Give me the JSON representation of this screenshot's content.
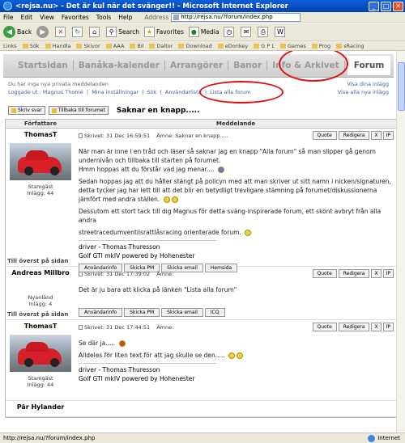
{
  "window": {
    "title": "<rejsa.nu> - Det är kul när det svänger!! - Microsoft Internet Explorer"
  },
  "menu": {
    "items": [
      "File",
      "Edit",
      "View",
      "Favorites",
      "Tools",
      "Help"
    ],
    "address_label": "Address",
    "url": "http://rejsa.nu/?forum/index.php"
  },
  "toolbar": {
    "back": "Back",
    "search": "Search",
    "favorites": "Favorites",
    "media": "Media"
  },
  "links": {
    "label": "Links",
    "items": [
      "Sök",
      "Handla",
      "Skivor",
      "AAA",
      "Bil",
      "Daltor",
      "Download",
      "eDonkey",
      "G P L",
      "Games",
      "Prog",
      "sRacing"
    ]
  },
  "nav": {
    "tabs": [
      "Startsidan",
      "Banåka-kalender",
      "Arrangörer",
      "Banor",
      "Info & Arkivet",
      "Forum"
    ]
  },
  "info": {
    "line1": "Du har inga nya privata meddelanden",
    "line2_prefix": "Loggade ut : Magnus Thomé",
    "mine": "Mina inställningar",
    "search": "Sök",
    "users": "Användarlista",
    "list_all": "Lista alla forum",
    "right1": "Visa dina inlägg",
    "right2": "Visa alla nya inlägg"
  },
  "buttons": {
    "reply": "Skriv svar",
    "back": "Tillbaka till forumet"
  },
  "thread": {
    "title": "Saknar en knapp....."
  },
  "table": {
    "col_author": "Författare",
    "col_message": "Meddelande"
  },
  "actions": {
    "quote": "Quote",
    "edit": "Redigera",
    "del": "X",
    "ip": "IP"
  },
  "foot_btns": {
    "info": "Användarinfo",
    "pm": "Skicka PM",
    "email": "Skicka email",
    "web": "Hemsida",
    "icq": "ICQ"
  },
  "posts": [
    {
      "author": "ThomasT",
      "rank": "Stamgäst",
      "count": "Inlägg: 44",
      "date": "Skrivet: 31 Dec 16:59:51",
      "subject": "Ämne: Saknar en knapp.....",
      "p1": "När man är inne i en tråd och läser så saknar jag en knapp \"Alla forum\" så man slipper gå genom undernivån och tillbaka till starten på forumet.",
      "p1b": "Hmm hoppas att du förstår vad jag menar....",
      "p2": "Sedan hoppas jag att du håller stängt på policyn med att man skriver ut sitt namn i nicken/signaturen, detta tycker jag har lett till att det blir en betydligt trevligare stämning på forumet/diskussionerna jämfört med andra ställen.",
      "p3": "Dessutom ett stort tack till dig Magnus för detta sväng-inspirerade forum, ett skönt avbryt från alla andra",
      "p4": "streetracedumventilsrattlåsracing orienterade forum.",
      "sig1": "driver - Thomas Thuresson",
      "sig2": "Golf GTI mkIV powered by Hohenester",
      "top": "Till överst på sidan"
    },
    {
      "author": "Andreas Millbro",
      "rank": "Nyanländ",
      "count": "Inlägg: 4",
      "date": "Skrivet: 31 Dec 17:39:02",
      "subject": "Ämne:",
      "p1": "Det är ju bara att klicka på länken \"Lista alla forum\"",
      "top": "Till överst på sidan"
    },
    {
      "author": "ThomasT",
      "rank": "Stamgäst",
      "count": "Inlägg: 44",
      "date": "Skrivet: 31 Dec 17:44:51",
      "subject": "Ämne:",
      "p1": "Se där ja.....",
      "p2": "Alldeles för liten text för att jag skulle se den.....",
      "sig1": "driver - Thomas Thuresson",
      "sig2": "Golf GTI mkIV powered by Hohenester"
    },
    {
      "author": "Pär Hylander"
    }
  ],
  "status": {
    "url": "http://rejsa.nu/?forum/index.php",
    "zone": "Internet"
  }
}
